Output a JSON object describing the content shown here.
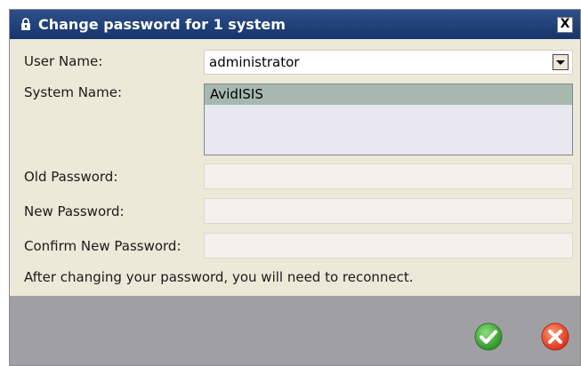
{
  "dialog": {
    "title": "Change password for 1 system",
    "close_label": "X"
  },
  "form": {
    "user_name_label": "User Name:",
    "user_name_value": "administrator",
    "system_name_label": "System Name:",
    "systems": [
      "AvidISIS"
    ],
    "old_password_label": "Old Password:",
    "new_password_label": "New Password:",
    "confirm_password_label": "Confirm New Password:",
    "note": "After changing your password, you will need to reconnect."
  },
  "icons": {
    "title": "lock-icon",
    "ok": "ok-checkmark-icon",
    "cancel": "cancel-x-icon"
  },
  "colors": {
    "titlebar": "#1f3f7a",
    "footer": "#a0a0a4",
    "selection": "#a7b9ae",
    "ok": "#3aa634",
    "cancel": "#e0412a"
  }
}
